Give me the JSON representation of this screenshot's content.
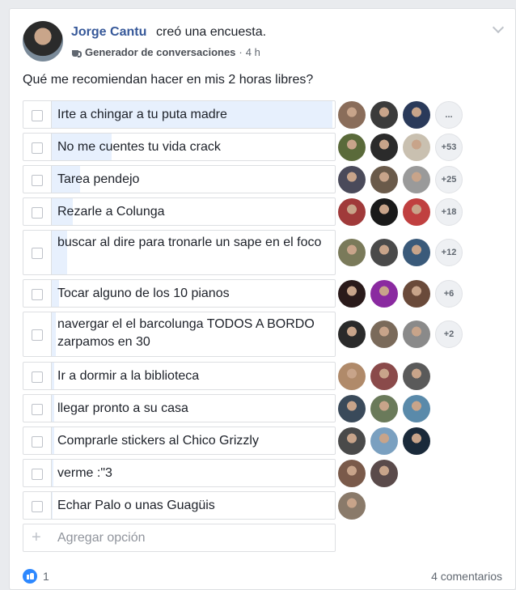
{
  "post": {
    "author": "Jorge Cantu",
    "action": "creó una encuesta.",
    "group": "Generador de conversaciones",
    "separator": "·",
    "time": "4 h",
    "question": "Qué me recomiendan hacer en mis 2 horas libres?"
  },
  "options": [
    {
      "label": "Irte a chingar a tu puta madre",
      "more": "...",
      "voters": 3
    },
    {
      "label": "No me cuentes tu vida crack",
      "more": "+53",
      "voters": 3
    },
    {
      "label": "Tarea pendejo",
      "more": "+25",
      "voters": 3
    },
    {
      "label": "Rezarle a Colunga",
      "more": "+18",
      "voters": 3
    },
    {
      "label": "buscar al dire para tronarle un sape en el foco",
      "more": "+12",
      "voters": 3
    },
    {
      "label": "Tocar alguno de los 10 pianos",
      "more": "+6",
      "voters": 3
    },
    {
      "label": "navergar el el barcolunga TODOS A BORDO zarpamos en 30",
      "more": "+2",
      "voters": 3
    },
    {
      "label": "Ir a dormir a la biblioteca",
      "more": "",
      "voters": 3
    },
    {
      "label": "llegar pronto a su casa",
      "more": "",
      "voters": 3
    },
    {
      "label": "Comprarle stickers al Chico Grizzly",
      "more": "",
      "voters": 3
    },
    {
      "label": "verme :\"3",
      "more": "",
      "voters": 2
    },
    {
      "label": "Echar Palo o unas Guagüis",
      "more": "",
      "voters": 1
    }
  ],
  "add_option_placeholder": "Agregar opción",
  "footer": {
    "like_count": "1",
    "comments": "4 comentarios"
  },
  "colors": {
    "accent": "#365899",
    "vote_fill": "#e7f0fd",
    "like_blue": "#2d88ff"
  },
  "icons": [
    "chevron-down-icon",
    "coffee-icon",
    "checkbox-icon",
    "plus-icon",
    "like-icon"
  ]
}
